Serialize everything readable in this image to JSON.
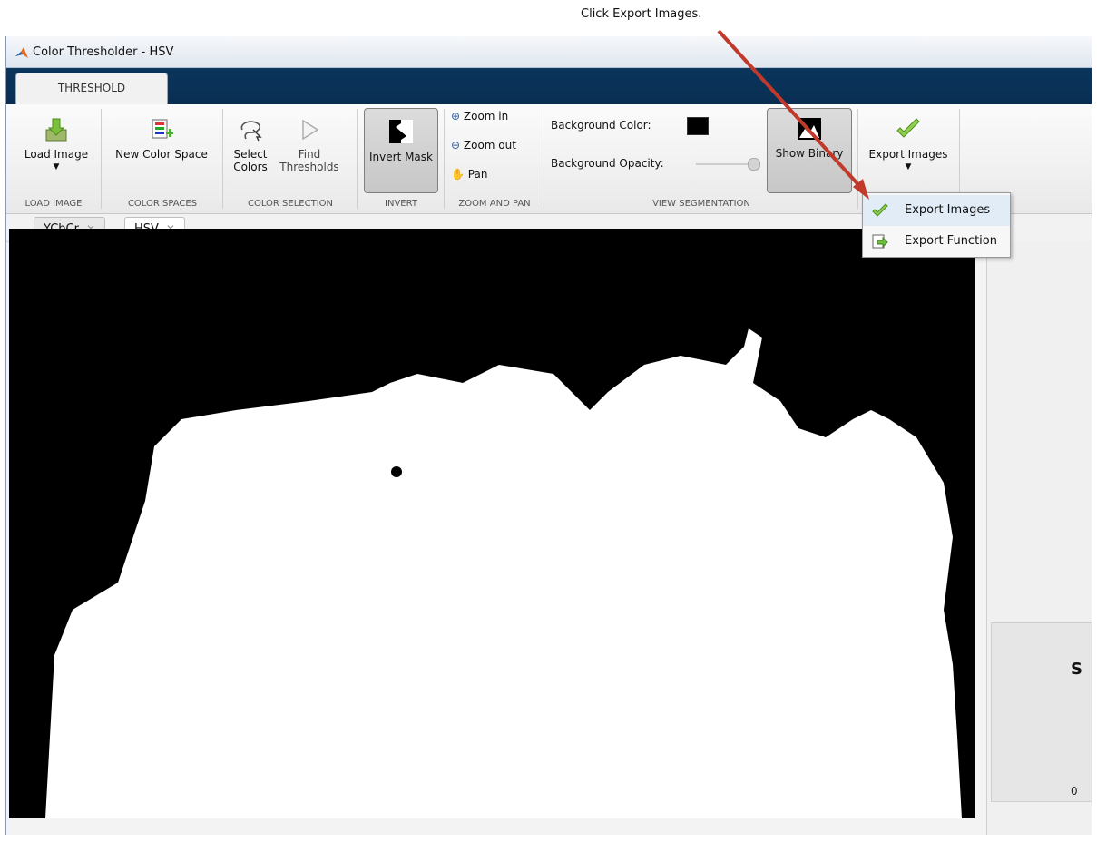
{
  "callout": "Click Export Images.",
  "window": {
    "title": "Color Thresholder - HSV"
  },
  "ribbon": {
    "tab": "THRESHOLD",
    "buttons": {
      "load_image": "Load Image",
      "new_color_space": "New Color Space",
      "select_colors_1": "Select",
      "select_colors_2": "Colors",
      "find_thresholds_1": "Find",
      "find_thresholds_2": "Thresholds",
      "invert_mask": "Invert Mask",
      "zoom_in": "Zoom in",
      "zoom_out": "Zoom out",
      "pan": "Pan",
      "background_color": "Background Color:",
      "background_opacity": "Background Opacity:",
      "show_binary": "Show Binary",
      "export_images": "Export Images"
    },
    "sections": [
      "LOAD IMAGE",
      "COLOR SPACES",
      "COLOR SELECTION",
      "INVERT",
      "ZOOM AND PAN",
      "VIEW SEGMENTATION"
    ]
  },
  "doc_tabs": [
    {
      "label": "YCbCr"
    },
    {
      "label": "HSV"
    }
  ],
  "export_menu": [
    {
      "label": "Export Images"
    },
    {
      "label": "Export Function"
    }
  ],
  "side_panel": {
    "label": "S",
    "value": "0"
  },
  "colors": {
    "ribbon_bar": "#0a2e52",
    "mask_background": "#000000",
    "mask_foreground": "#ffffff",
    "arrow": "#c0392b"
  }
}
